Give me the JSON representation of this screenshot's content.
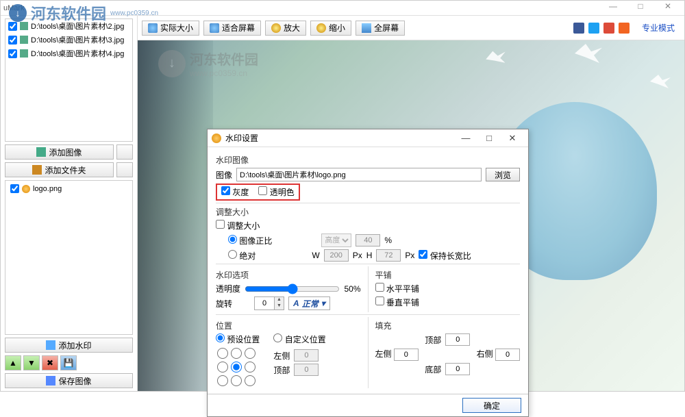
{
  "app": {
    "title": "uMark"
  },
  "overlay": {
    "site_name": "河东软件园",
    "site_url": "www.pc0359.cn"
  },
  "window_controls": {
    "min": "—",
    "max": "□",
    "close": "✕"
  },
  "files": [
    {
      "checked": true,
      "path": "D:\\tools\\桌面\\图片素材\\2.jpg"
    },
    {
      "checked": true,
      "path": "D:\\tools\\桌面\\图片素材\\3.jpg"
    },
    {
      "checked": true,
      "path": "D:\\tools\\桌面\\图片素材\\4.jpg"
    }
  ],
  "left": {
    "add_image": "添加图像",
    "add_folder": "添加文件夹",
    "logo_item": "logo.png",
    "add_watermark": "添加水印",
    "save_image": "保存图像"
  },
  "toolbar": {
    "actual": "实际大小",
    "fit": "适合屏幕",
    "zoom_in": "放大",
    "zoom_out": "缩小",
    "fullscreen": "全屏幕",
    "pro_mode": "专业模式"
  },
  "social": {
    "fb": "#3b5998",
    "tw": "#1da1f2",
    "gp": "#dd4b39",
    "rss": "#f26522"
  },
  "dialog": {
    "title": "水印设置",
    "section_image": "水印图像",
    "lbl_image": "图像",
    "image_path": "D:\\tools\\桌面\\图片素材\\logo.png",
    "browse": "浏览",
    "chk_gray": "灰度",
    "chk_transcolor": "透明色",
    "section_resize": "调整大小",
    "chk_resize": "调整大小",
    "opt_proportional": "图像正比",
    "prop_dim": "高度",
    "prop_value": "40",
    "prop_unit": "%",
    "opt_absolute": "绝对",
    "abs_w_lbl": "W",
    "abs_w": "200",
    "abs_h_lbl": "H",
    "abs_h": "72",
    "abs_px": "Px",
    "keep_ratio": "保持长宽比",
    "section_options": "水印选项",
    "opacity_lbl": "透明度",
    "opacity_val": "50%",
    "rotate_lbl": "旋转",
    "rotate_val": "0",
    "flip_style": "正常",
    "section_tile": "平铺",
    "tile_h": "水平平铺",
    "tile_v": "垂直平铺",
    "section_pos": "位置",
    "opt_preset": "预设位置",
    "opt_custom": "自定义位置",
    "left_lbl": "左侧",
    "left_val": "0",
    "top_lbl": "顶部",
    "top_val": "0",
    "section_pad": "填充",
    "pad_top_lbl": "顶部",
    "pad_top": "0",
    "pad_left_lbl": "左侧",
    "pad_left": "0",
    "pad_right_lbl": "右侧",
    "pad_right": "0",
    "pad_bottom_lbl": "底部",
    "pad_bottom": "0",
    "ok": "确定"
  }
}
